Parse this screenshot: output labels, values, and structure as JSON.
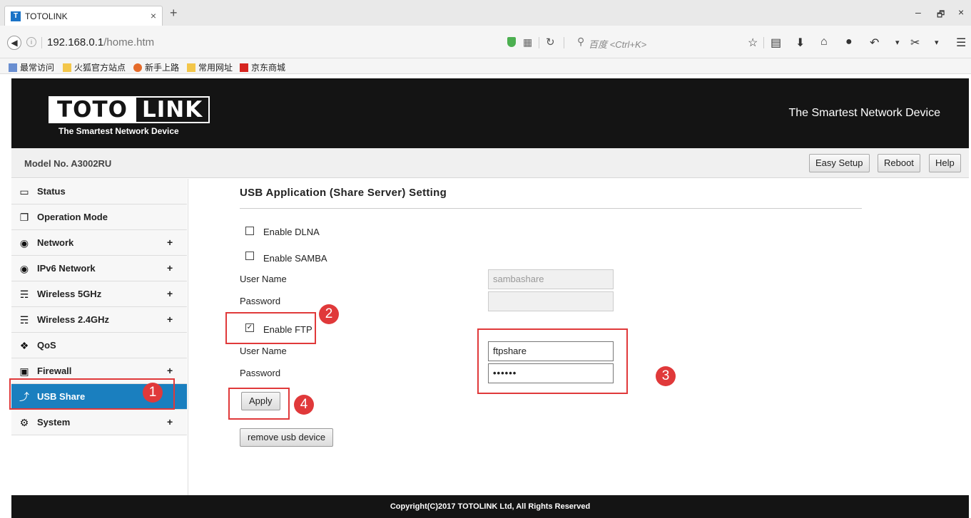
{
  "browser": {
    "tab_title": "TOTOLINK",
    "tab_close": "×",
    "tab_new": "+",
    "favicon_letter": "T",
    "url_host": "192.168.0.1",
    "url_path": "/home.htm",
    "search_placeholder": "百度 <Ctrl+K>",
    "bookmarks": [
      "最常访问",
      "火狐官方站点",
      "新手上路",
      "常用网址",
      "京东商城"
    ],
    "window_controls": [
      "–",
      "🗗",
      "×"
    ],
    "icons": [
      "back-icon",
      "info-icon",
      "shield-icon",
      "qr-code-icon",
      "reload-icon",
      "search-icon",
      "star-icon",
      "reading-list-icon",
      "download-icon",
      "home-icon",
      "chat-icon",
      "undo-icon",
      "screenshot-icon",
      "menu-icon"
    ]
  },
  "header": {
    "logo_left": "TOTO",
    "logo_right": "LINK",
    "logo_sub": "The Smartest Network Device",
    "tagline": "The Smartest Network Device"
  },
  "modelbar": {
    "model": "Model No. A3002RU",
    "buttons": {
      "easy_setup": "Easy Setup",
      "reboot": "Reboot",
      "help": "Help"
    }
  },
  "sidebar": {
    "items": [
      {
        "label": "Status",
        "icon": "chat-bubble-icon",
        "expandable": false
      },
      {
        "label": "Operation Mode",
        "icon": "windows-icon",
        "expandable": false
      },
      {
        "label": "Network",
        "icon": "globe-icon",
        "expandable": true
      },
      {
        "label": "IPv6 Network",
        "icon": "globe-icon",
        "expandable": true
      },
      {
        "label": "Wireless 5GHz",
        "icon": "wifi-icon",
        "expandable": true
      },
      {
        "label": "Wireless 2.4GHz",
        "icon": "wifi-icon",
        "expandable": true
      },
      {
        "label": "QoS",
        "icon": "arrows-icon",
        "expandable": false
      },
      {
        "label": "Firewall",
        "icon": "lock-icon",
        "expandable": true
      },
      {
        "label": "USB Share",
        "icon": "usb-icon",
        "expandable": false,
        "active": true
      },
      {
        "label": "System",
        "icon": "gear-icon",
        "expandable": true
      }
    ],
    "plus": "+"
  },
  "content": {
    "title": "USB Application (Share Server) Setting",
    "enable_dlna": {
      "label": "Enable DLNA",
      "checked": false
    },
    "enable_samba": {
      "label": "Enable SAMBA",
      "checked": false
    },
    "samba_username_label": "User Name",
    "samba_username_value": "sambashare",
    "samba_password_label": "Password",
    "samba_password_value": "",
    "enable_ftp": {
      "label": "Enable FTP",
      "checked": true
    },
    "ftp_username_label": "User Name",
    "ftp_username_value": "ftpshare",
    "ftp_password_label": "Password",
    "ftp_password_value": "••••••",
    "apply_label": "Apply",
    "remove_label": "remove usb device"
  },
  "annotations": {
    "color": "#e0393a",
    "badges": [
      "1",
      "2",
      "3",
      "4"
    ]
  },
  "footer": {
    "text": "Copyright(C)2017 TOTOLINK Ltd, All Rights Reserved"
  },
  "colors": {
    "header_bg": "#141414",
    "active_item": "#1a7fbf",
    "annotation_red": "#e0393a"
  }
}
